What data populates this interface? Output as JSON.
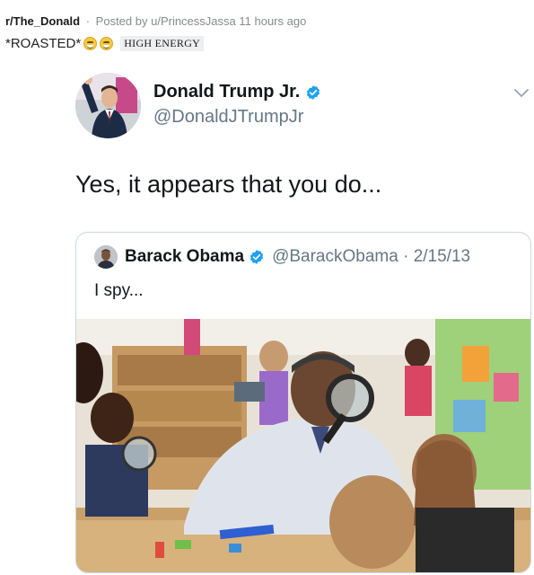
{
  "post": {
    "subreddit": "r/The_Donald",
    "separator": "·",
    "posted_by": "Posted by u/PrincessJassa",
    "time": "11 hours ago",
    "title": "*ROASTED*",
    "flair": "HIGH ENERGY",
    "emoji_icon": "grinning-squinting-face-icon"
  },
  "tweet": {
    "author_name": "Donald Trump Jr.",
    "author_handle": "@DonaldJTrumpJr",
    "text": "Yes, it appears that you do...",
    "quote": {
      "author_name": "Barack Obama",
      "handle_date": "@BarackObama · 2/15/13",
      "text": "I spy..."
    }
  },
  "colors": {
    "verified": "#1da1f2",
    "meta_gray": "#878a8c",
    "handle_gray": "#657786",
    "border": "#ccd6dd"
  }
}
